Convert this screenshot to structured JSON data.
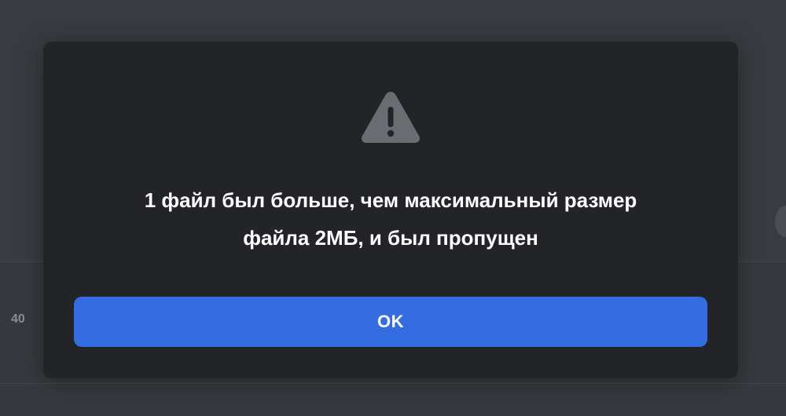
{
  "background": {
    "row_number": "40"
  },
  "dialog": {
    "icon": "warning-triangle-icon",
    "message_line1": "1 файл был больше, чем максимальный размер",
    "message_line2": "файла 2МБ, и был пропущен",
    "ok_label": "OK"
  },
  "colors": {
    "dialog_background": "#232428",
    "button_accent": "#346ce1",
    "icon_color": "#6a6c72",
    "page_background": "#37393e"
  }
}
